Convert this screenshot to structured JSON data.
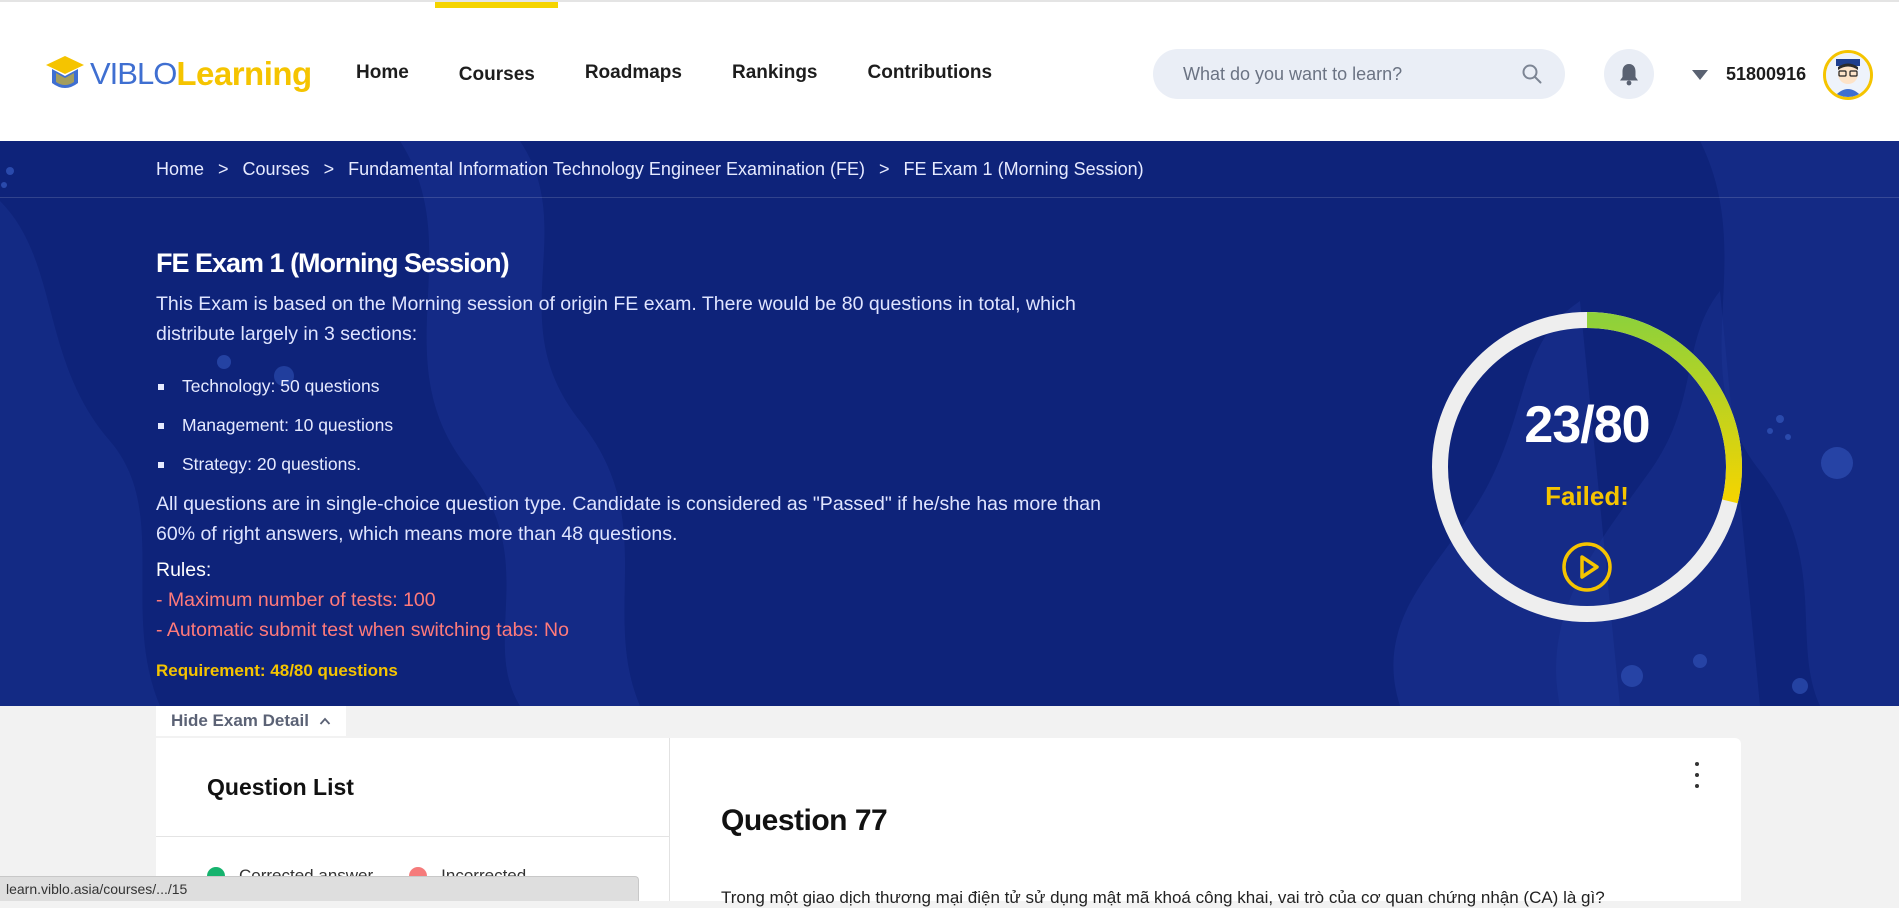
{
  "header": {
    "logo": {
      "viblo": "VIBLO",
      "learning": "Learning"
    },
    "nav": [
      "Home",
      "Courses",
      "Roadmaps",
      "Rankings",
      "Contributions"
    ],
    "search_placeholder": "What do you want to learn?",
    "username": "51800916"
  },
  "breadcrumb": [
    "Home",
    "Courses",
    "Fundamental Information Technology Engineer Examination (FE)",
    "FE Exam 1 (Morning Session)"
  ],
  "breadcrumb_separator": ">",
  "exam": {
    "title": "FE Exam 1 (Morning Session)",
    "description": "This Exam is based on the Morning session of origin FE exam. There would be 80 questions in total, which distribute largely in 3 sections:",
    "sections": [
      "Technology: 50 questions",
      "Management: 10 questions",
      "Strategy: 20 questions."
    ],
    "criteria": "All questions are in single-choice question type. Candidate is considered as \"Passed\" if he/she has more than 60% of right answers, which means more than 48 questions.",
    "rules_label": "Rules:",
    "rules": [
      "- Maximum number of tests: 100",
      "- Automatic submit test when switching tabs: No"
    ],
    "requirement": "Requirement: 48/80 questions"
  },
  "result": {
    "score": "23/80",
    "correct": 23,
    "total": 80,
    "status": "Failed!"
  },
  "toggle_label": "Hide Exam Detail",
  "question_list": {
    "title": "Question List",
    "legend": [
      "Corrected answer",
      "Incorrected"
    ]
  },
  "question": {
    "title": "Question 77",
    "text": "Trong một giao dịch thương mại điện tử sử dụng mật mã khoá công khai, vai trò của cơ quan chứng nhận (CA) là gì?"
  },
  "status_url": "learn.viblo.asia/courses/.../15",
  "colors": {
    "accent_yellow": "#f5c400",
    "banner_blue": "#0e237a",
    "rule_red": "#ff7a7a",
    "correct_green": "#16b36e",
    "incorrect_red": "#f57b7b"
  }
}
